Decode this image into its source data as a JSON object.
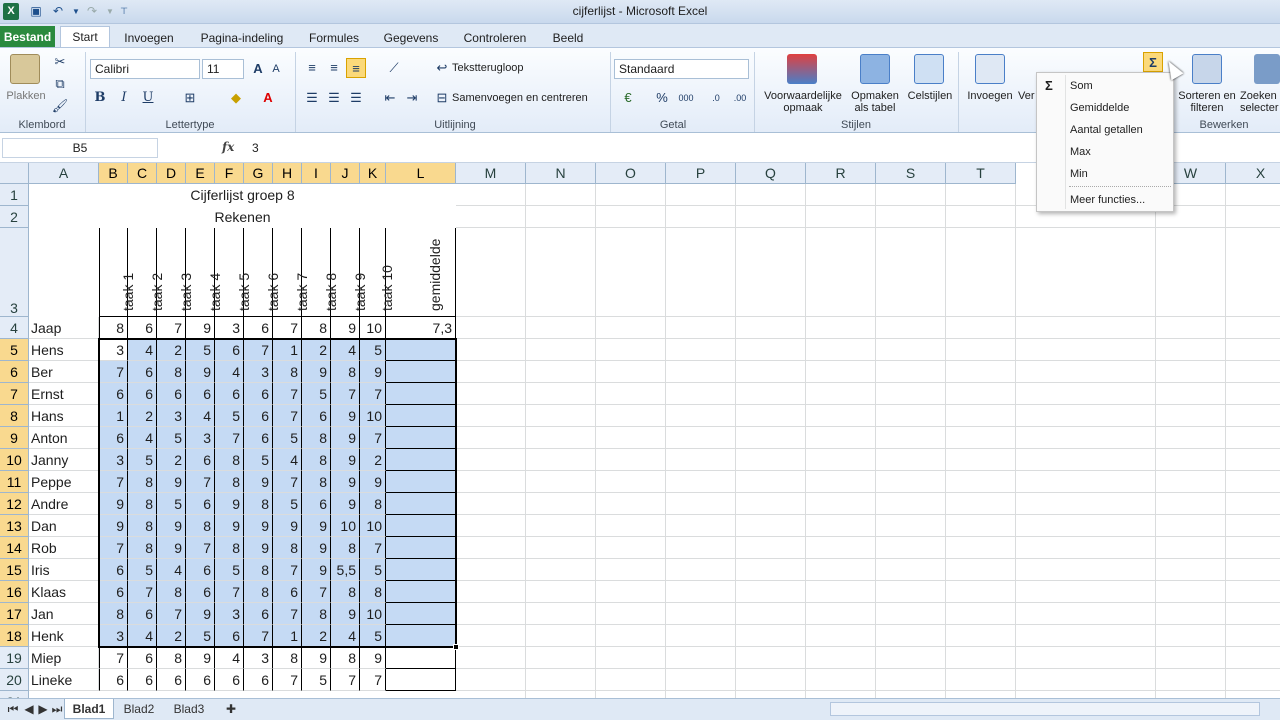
{
  "window": {
    "title": "cijferlijst  -  Microsoft Excel"
  },
  "tabs": [
    "Bestand",
    "Start",
    "Invoegen",
    "Pagina-indeling",
    "Formules",
    "Gegevens",
    "Controleren",
    "Beeld"
  ],
  "ribbon": {
    "clipboard": {
      "paste": "Plakken",
      "label": "Klembord"
    },
    "font": {
      "name": "Calibri",
      "size": "11",
      "label": "Lettertype"
    },
    "alignment": {
      "wrap": "Tekstterugloop",
      "merge": "Samenvoegen en centreren",
      "label": "Uitlijning"
    },
    "number": {
      "format": "Standaard",
      "label": "Getal"
    },
    "styles": {
      "conditional": "Voorwaardelijke opmaak",
      "table": "Opmaken als tabel",
      "cell": "Celstijlen",
      "label": "Stijlen"
    },
    "cells": {
      "insert": "Invoegen",
      "delete": "Ver"
    },
    "editing": {
      "sort": "Sorteren en filteren",
      "find": "Zoeken selecter",
      "label": "Bewerken"
    }
  },
  "formula_bar": {
    "name_box": "B5",
    "fx": "fx",
    "value": "3"
  },
  "columns": [
    "A",
    "B",
    "C",
    "D",
    "E",
    "F",
    "G",
    "H",
    "I",
    "J",
    "K",
    "L",
    "M",
    "N",
    "O",
    "P",
    "Q",
    "R",
    "S",
    "T",
    "",
    "W",
    "X"
  ],
  "sheet": {
    "title": "Cijferlijst groep 8",
    "subtitle": "Rekenen",
    "headers": [
      "taak 1",
      "taak 2",
      "taak 3",
      "taak 4",
      "taak 5",
      "taak 6",
      "taak 7",
      "taak 8",
      "taak 9",
      "taak 10",
      "gemiddelde"
    ],
    "rows": [
      {
        "num": "4",
        "name": "Jaap",
        "scores": [
          "8",
          "6",
          "7",
          "9",
          "3",
          "6",
          "7",
          "8",
          "9",
          "10"
        ],
        "avg": "7,3"
      },
      {
        "num": "5",
        "name": "Hens",
        "scores": [
          "3",
          "4",
          "2",
          "5",
          "6",
          "7",
          "1",
          "2",
          "4",
          "5"
        ],
        "avg": ""
      },
      {
        "num": "6",
        "name": "Ber",
        "scores": [
          "7",
          "6",
          "8",
          "9",
          "4",
          "3",
          "8",
          "9",
          "8",
          "9"
        ],
        "avg": ""
      },
      {
        "num": "7",
        "name": "Ernst",
        "scores": [
          "6",
          "6",
          "6",
          "6",
          "6",
          "6",
          "7",
          "5",
          "7",
          "7"
        ],
        "avg": ""
      },
      {
        "num": "8",
        "name": "Hans",
        "scores": [
          "1",
          "2",
          "3",
          "4",
          "5",
          "6",
          "7",
          "6",
          "9",
          "10"
        ],
        "avg": ""
      },
      {
        "num": "9",
        "name": "Anton",
        "scores": [
          "6",
          "4",
          "5",
          "3",
          "7",
          "6",
          "5",
          "8",
          "9",
          "7"
        ],
        "avg": ""
      },
      {
        "num": "10",
        "name": "Janny",
        "scores": [
          "3",
          "5",
          "2",
          "6",
          "8",
          "5",
          "4",
          "8",
          "9",
          "2"
        ],
        "avg": ""
      },
      {
        "num": "11",
        "name": "Peppe",
        "scores": [
          "7",
          "8",
          "9",
          "7",
          "8",
          "9",
          "7",
          "8",
          "9",
          "9"
        ],
        "avg": ""
      },
      {
        "num": "12",
        "name": "Andre",
        "scores": [
          "9",
          "8",
          "5",
          "6",
          "9",
          "8",
          "5",
          "6",
          "9",
          "8"
        ],
        "avg": ""
      },
      {
        "num": "13",
        "name": "Dan",
        "scores": [
          "9",
          "8",
          "9",
          "8",
          "9",
          "9",
          "9",
          "9",
          "10",
          "10"
        ],
        "avg": ""
      },
      {
        "num": "14",
        "name": "Rob",
        "scores": [
          "7",
          "8",
          "9",
          "7",
          "8",
          "9",
          "8",
          "9",
          "8",
          "7"
        ],
        "avg": ""
      },
      {
        "num": "15",
        "name": "Iris",
        "scores": [
          "6",
          "5",
          "4",
          "6",
          "5",
          "8",
          "7",
          "9",
          "5,5",
          "5"
        ],
        "avg": ""
      },
      {
        "num": "16",
        "name": "Klaas",
        "scores": [
          "6",
          "7",
          "8",
          "6",
          "7",
          "8",
          "6",
          "7",
          "8",
          "8"
        ],
        "avg": ""
      },
      {
        "num": "17",
        "name": "Jan",
        "scores": [
          "8",
          "6",
          "7",
          "9",
          "3",
          "6",
          "7",
          "8",
          "9",
          "10"
        ],
        "avg": ""
      },
      {
        "num": "18",
        "name": "Henk",
        "scores": [
          "3",
          "4",
          "2",
          "5",
          "6",
          "7",
          "1",
          "2",
          "4",
          "5"
        ],
        "avg": ""
      },
      {
        "num": "19",
        "name": "Miep",
        "scores": [
          "7",
          "6",
          "8",
          "9",
          "4",
          "3",
          "8",
          "9",
          "8",
          "9"
        ],
        "avg": ""
      },
      {
        "num": "20",
        "name": "Lineke",
        "scores": [
          "6",
          "6",
          "6",
          "6",
          "6",
          "6",
          "7",
          "5",
          "7",
          "7"
        ],
        "avg": ""
      }
    ]
  },
  "autosum_menu": {
    "items": [
      "Som",
      "Gemiddelde",
      "Aantal getallen",
      "Max",
      "Min",
      "Meer functies..."
    ],
    "sigma": "Σ"
  },
  "sheet_tabs": [
    "Blad1",
    "Blad2",
    "Blad3"
  ]
}
